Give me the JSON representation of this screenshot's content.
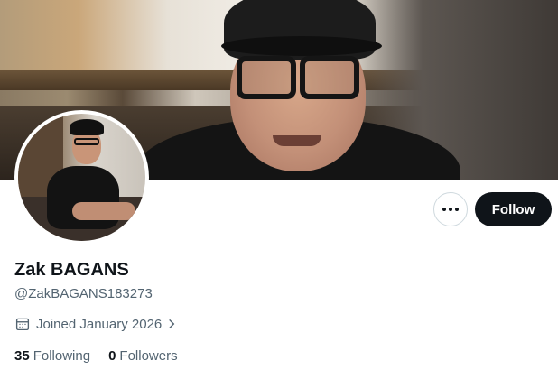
{
  "profile": {
    "display_name": "Zak BAGANS",
    "handle": "@ZakBAGANS183273",
    "joined": "Joined January 2026"
  },
  "actions": {
    "follow_label": "Follow",
    "more_icon": "ellipsis-icon"
  },
  "stats": {
    "following_count": "35",
    "following_label": "Following",
    "followers_count": "0",
    "followers_label": "Followers"
  },
  "colors": {
    "primary_text": "#0f1419",
    "secondary_text": "#536471",
    "follow_button_bg": "#0f1419",
    "border": "#cfd9de"
  }
}
